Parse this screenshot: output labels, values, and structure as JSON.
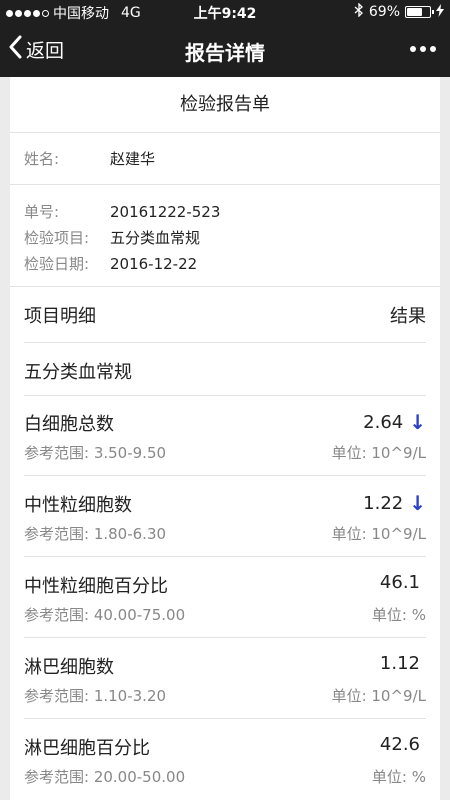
{
  "status_bar": {
    "carrier": "中国移动",
    "network": "4G",
    "time": "上午9:42",
    "battery_text": "69%",
    "battery_level": 0.69,
    "bluetooth_icon": "bluetooth-icon",
    "charging_icon": "charging-bolt-icon"
  },
  "nav": {
    "back_label": "返回",
    "title": "报告详情",
    "more_icon": "more-dots-icon"
  },
  "report": {
    "title": "检验报告单",
    "name_label": "姓名:",
    "name_value": "赵建华",
    "order_label": "单号:",
    "order_value": "20161222-523",
    "item_label": "检验项目:",
    "item_value": "五分类血常规",
    "date_label": "检验日期:",
    "date_value": "2016-12-22"
  },
  "table": {
    "header_left": "项目明细",
    "header_right": "结果",
    "group_title": "五分类血常规",
    "rows": [
      {
        "name": "白细胞总数",
        "value": "2.64",
        "arrow": "↓",
        "range": "参考范围: 3.50-9.50",
        "unit": "单位: 10^9/L"
      },
      {
        "name": "中性粒细胞数",
        "value": "1.22",
        "arrow": "↓",
        "range": "参考范围: 1.80-6.30",
        "unit": "单位: 10^9/L"
      },
      {
        "name": "中性粒细胞百分比",
        "value": "46.1",
        "arrow": "",
        "range": "参考范围: 40.00-75.00",
        "unit": "单位: %"
      },
      {
        "name": "淋巴细胞数",
        "value": "1.12",
        "arrow": "",
        "range": "参考范围: 1.10-3.20",
        "unit": "单位: 10^9/L"
      },
      {
        "name": "淋巴细胞百分比",
        "value": "42.6",
        "arrow": "",
        "range": "参考范围: 20.00-50.00",
        "unit": "单位: %"
      }
    ]
  },
  "colors": {
    "bar_bg": "#1f1f1f",
    "low_arrow": "#2b40c9"
  }
}
